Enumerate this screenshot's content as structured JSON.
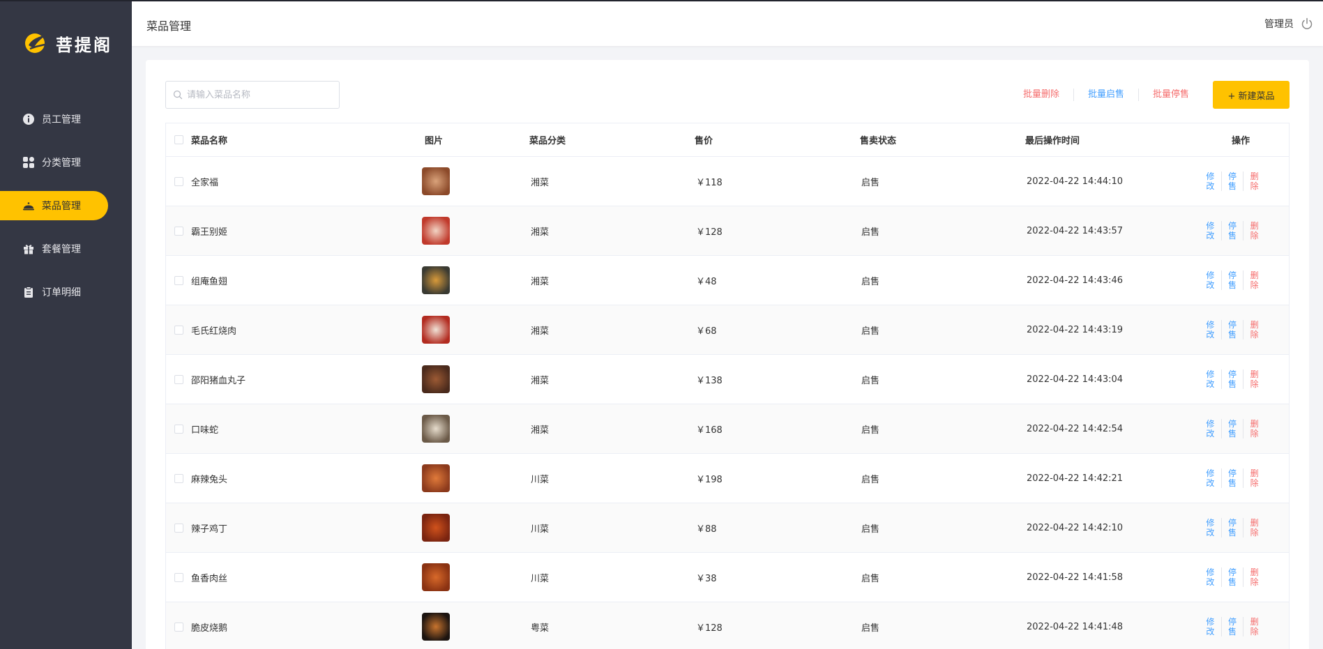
{
  "brand": {
    "name": "菩提阁",
    "accent": "#ffc200",
    "sidebar_bg": "#343744"
  },
  "nav": [
    {
      "label": "员工管理",
      "icon": "info-circle-icon",
      "active": false
    },
    {
      "label": "分类管理",
      "icon": "grid-icon",
      "active": false
    },
    {
      "label": "菜品管理",
      "icon": "cloche-icon",
      "active": true
    },
    {
      "label": "套餐管理",
      "icon": "gift-icon",
      "active": false
    },
    {
      "label": "订单明细",
      "icon": "clipboard-icon",
      "active": false
    }
  ],
  "header": {
    "title": "菜品管理",
    "user": "管理员",
    "logout_icon": "power-icon"
  },
  "toolbar": {
    "search_placeholder": "请输入菜品名称",
    "batch_delete": "批量删除",
    "batch_enable": "批量启售",
    "batch_disable": "批量停售",
    "add_button": "+ 新建菜品"
  },
  "table": {
    "columns": [
      "菜品名称",
      "图片",
      "菜品分类",
      "售价",
      "售卖状态",
      "最后操作时间",
      "操作"
    ],
    "ops": {
      "edit": "修改",
      "toggle": "停售",
      "delete": "删除"
    },
    "rows": [
      {
        "name": "全家福",
        "category": "湘菜",
        "price": "￥118",
        "status": "启售",
        "time": "2022-04-22 14:44:10",
        "thumb": [
          "#8c4a2a",
          "#d9a27a"
        ]
      },
      {
        "name": "霸王别姬",
        "category": "湘菜",
        "price": "￥128",
        "status": "启售",
        "time": "2022-04-22 14:43:57",
        "thumb": [
          "#c0392b",
          "#f2d4c4"
        ]
      },
      {
        "name": "组庵鱼翅",
        "category": "湘菜",
        "price": "￥48",
        "status": "启售",
        "time": "2022-04-22 14:43:46",
        "thumb": [
          "#3a3a32",
          "#d89a3a"
        ]
      },
      {
        "name": "毛氏红烧肉",
        "category": "湘菜",
        "price": "￥68",
        "status": "启售",
        "time": "2022-04-22 14:43:19",
        "thumb": [
          "#b22b20",
          "#f0e2d6"
        ]
      },
      {
        "name": "邵阳猪血丸子",
        "category": "湘菜",
        "price": "￥138",
        "status": "启售",
        "time": "2022-04-22 14:43:04",
        "thumb": [
          "#4a2a1c",
          "#9c5a34"
        ]
      },
      {
        "name": "口味蛇",
        "category": "湘菜",
        "price": "￥168",
        "status": "启售",
        "time": "2022-04-22 14:42:54",
        "thumb": [
          "#6b5a48",
          "#e6dccc"
        ]
      },
      {
        "name": "麻辣兔头",
        "category": "川菜",
        "price": "￥198",
        "status": "启售",
        "time": "2022-04-22 14:42:21",
        "thumb": [
          "#8c3a1c",
          "#e07a3a"
        ]
      },
      {
        "name": "辣子鸡丁",
        "category": "川菜",
        "price": "￥88",
        "status": "启售",
        "time": "2022-04-22 14:42:10",
        "thumb": [
          "#7a2410",
          "#d0521c"
        ]
      },
      {
        "name": "鱼香肉丝",
        "category": "川菜",
        "price": "￥38",
        "status": "启售",
        "time": "2022-04-22 14:41:58",
        "thumb": [
          "#8a3212",
          "#d8692a"
        ]
      },
      {
        "name": "脆皮烧鹅",
        "category": "粤菜",
        "price": "￥128",
        "status": "启售",
        "time": "2022-04-22 14:41:48",
        "thumb": [
          "#1c1410",
          "#c8742e"
        ]
      }
    ]
  }
}
